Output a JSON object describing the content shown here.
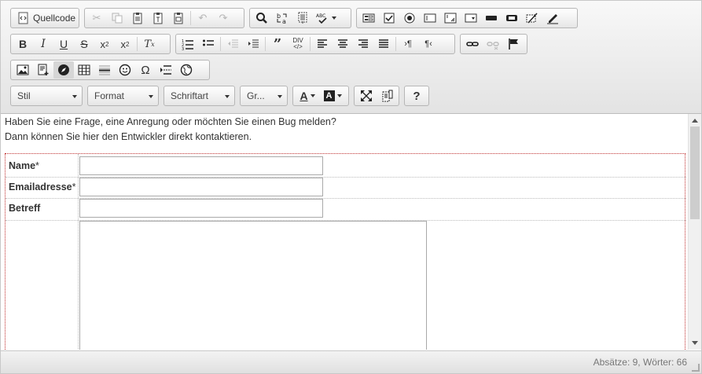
{
  "toolbar": {
    "source_label": "Quellcode",
    "combos": {
      "style": "Stil",
      "format": "Format",
      "font": "Schriftart",
      "size": "Gr..."
    },
    "help_label": "?"
  },
  "content": {
    "line1": "Haben Sie eine Frage, eine Anregung oder möchten Sie einen Bug melden?",
    "line2": "Dann können Sie hier den Entwickler direkt kontaktieren."
  },
  "form": {
    "name_label": "Name",
    "email_label": "Emailadresse",
    "subject_label": "Betreff",
    "required_mark": "*",
    "name_value": "",
    "email_value": "",
    "subject_value": "",
    "message_value": ""
  },
  "status": {
    "text": "Absätze: 9, Wörter: 66"
  }
}
